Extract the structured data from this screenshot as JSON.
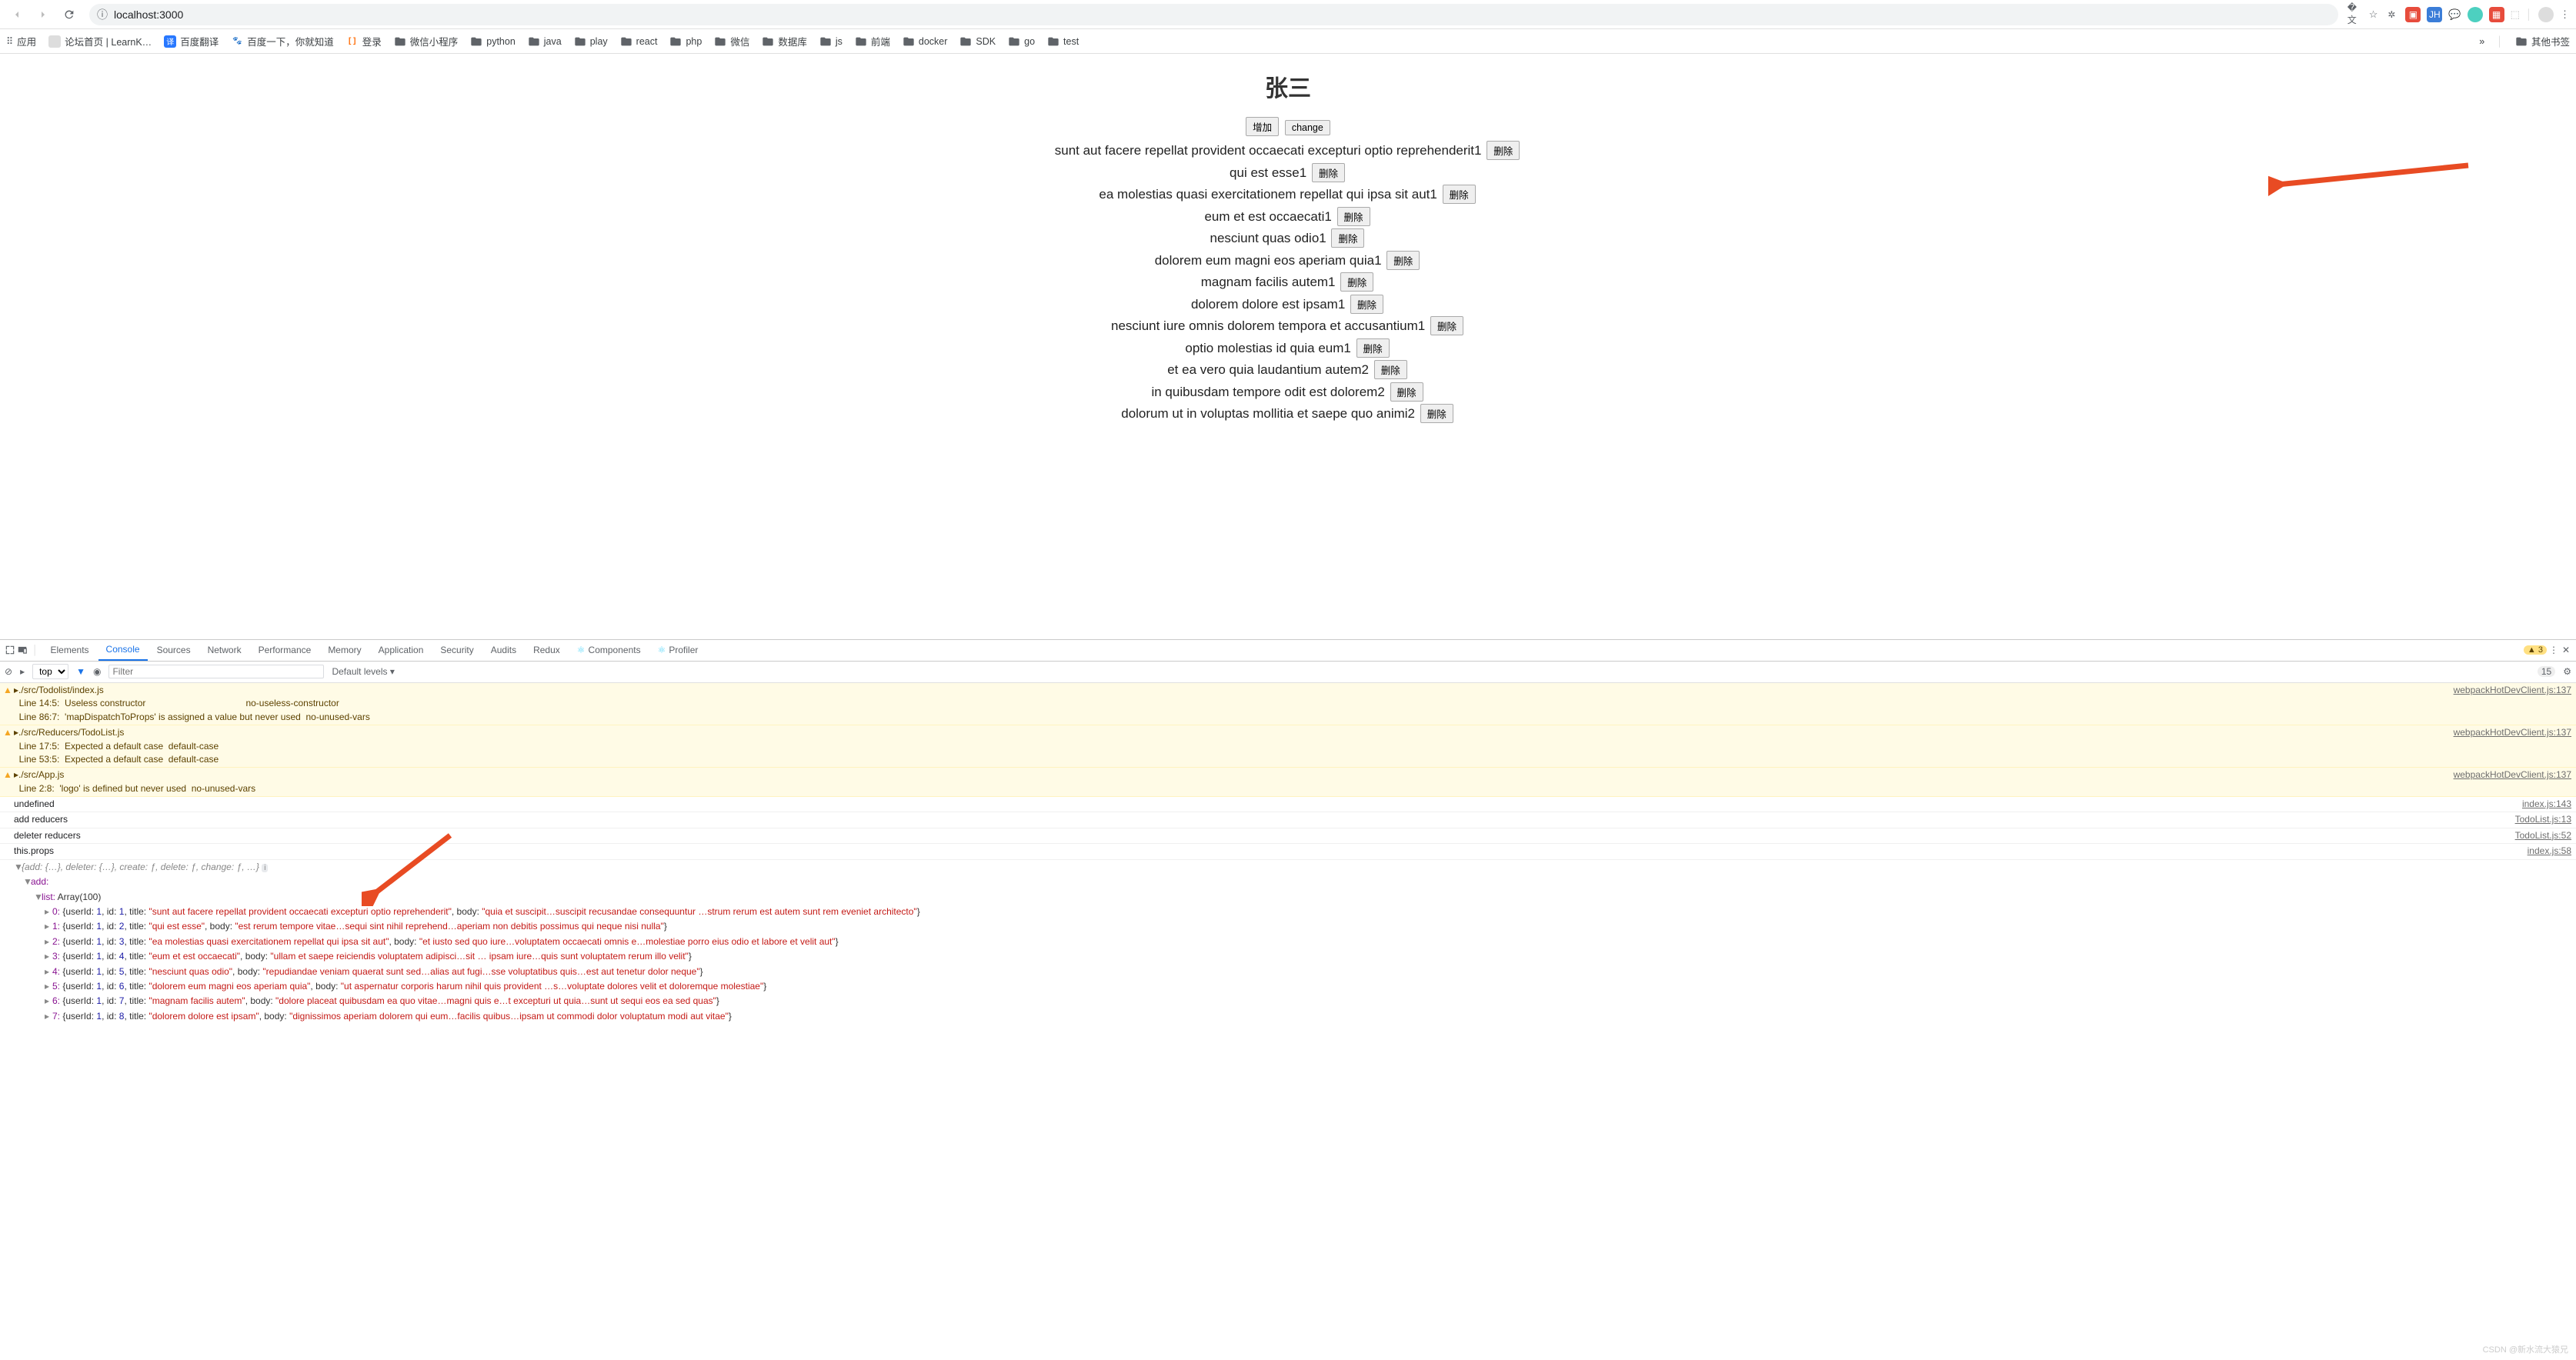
{
  "toolbar": {
    "url": "localhost:3000"
  },
  "bookmarks": {
    "apps": "应用",
    "items": [
      {
        "label": "论坛首页 | LearnK…",
        "iconBg": "#ddd",
        "iconTxt": "",
        "type": "img"
      },
      {
        "label": "百度翻译",
        "iconBg": "#2878ff",
        "iconTxt": "译",
        "type": "img"
      },
      {
        "label": "百度一下，你就知道",
        "iconBg": "#fff",
        "iconTxt": "",
        "type": "paw"
      },
      {
        "label": "登录",
        "iconBg": "#ff6a00",
        "iconTxt": "",
        "type": "bracket"
      },
      {
        "label": "微信小程序",
        "type": "folder"
      },
      {
        "label": "python",
        "type": "folder"
      },
      {
        "label": "java",
        "type": "folder"
      },
      {
        "label": "play",
        "type": "folder"
      },
      {
        "label": "react",
        "type": "folder"
      },
      {
        "label": "php",
        "type": "folder"
      },
      {
        "label": "微信",
        "type": "folder"
      },
      {
        "label": "数据库",
        "type": "folder"
      },
      {
        "label": "js",
        "type": "folder"
      },
      {
        "label": "前端",
        "type": "folder"
      },
      {
        "label": "docker",
        "type": "folder"
      },
      {
        "label": "SDK",
        "type": "folder"
      },
      {
        "label": "go",
        "type": "folder"
      },
      {
        "label": "test",
        "type": "folder"
      }
    ],
    "more": "»",
    "other": "其他书签"
  },
  "page": {
    "title": "张三",
    "add_label": "增加",
    "change_label": "change",
    "delete_label": "删除",
    "items": [
      "sunt aut facere repellat provident occaecati excepturi optio reprehenderit1",
      "qui est esse1",
      "ea molestias quasi exercitationem repellat qui ipsa sit aut1",
      "eum et est occaecati1",
      "nesciunt quas odio1",
      "dolorem eum magni eos aperiam quia1",
      "magnam facilis autem1",
      "dolorem dolore est ipsam1",
      "nesciunt iure omnis dolorem tempora et accusantium1",
      "optio molestias id quia eum1",
      "et ea vero quia laudantium autem2",
      "in quibusdam tempore odit est dolorem2",
      "dolorum ut in voluptas mollitia et saepe quo animi2"
    ]
  },
  "devtools": {
    "tabs": [
      "Elements",
      "Console",
      "Sources",
      "Network",
      "Performance",
      "Memory",
      "Application",
      "Security",
      "Audits",
      "Redux",
      "Components",
      "Profiler"
    ],
    "active_tab": "Console",
    "warn_count": "3",
    "hidden_count": "15",
    "context": "top",
    "filter_placeholder": "Filter",
    "levels": "Default levels",
    "warnings": [
      {
        "src": "webpackHotDevClient.js:137",
        "lines": [
          "./src/Todolist/index.js",
          "  Line 14:5:  Useless constructor                                       no-useless-constructor",
          "  Line 86:7:  'mapDispatchToProps' is assigned a value but never used  no-unused-vars"
        ]
      },
      {
        "src": "webpackHotDevClient.js:137",
        "lines": [
          "./src/Reducers/TodoList.js",
          "  Line 17:5:  Expected a default case  default-case",
          "  Line 53:5:  Expected a default case  default-case"
        ]
      },
      {
        "src": "webpackHotDevClient.js:137",
        "lines": [
          "./src/App.js",
          "  Line 2:8:  'logo' is defined but never used  no-unused-vars"
        ]
      }
    ],
    "logs": [
      {
        "txt": "undefined",
        "src": "index.js:143"
      },
      {
        "txt": "add reducers",
        "src": "TodoList.js:13"
      },
      {
        "txt": "deleter reducers",
        "src": "TodoList.js:52"
      },
      {
        "txt": "this.props",
        "src": "index.js:58"
      }
    ],
    "object_summary": "{add: {…}, deleter: {…}, create: ƒ, delete: ƒ, change: ƒ, …}",
    "add_key": "add:",
    "list_label": "list: ",
    "list_type": "Array(100)",
    "list_items": [
      {
        "idx": "0",
        "userId": "1",
        "id": "1",
        "title": "sunt aut facere repellat provident occaecati excepturi optio reprehenderit",
        "body": "quia et suscipit…suscipit recusandae consequuntur …strum rerum est autem sunt rem eveniet architecto"
      },
      {
        "idx": "1",
        "userId": "1",
        "id": "2",
        "title": "qui est esse",
        "body": "est rerum tempore vitae…sequi sint nihil reprehend…aperiam non debitis possimus qui neque nisi nulla"
      },
      {
        "idx": "2",
        "userId": "1",
        "id": "3",
        "title": "ea molestias quasi exercitationem repellat qui ipsa sit aut",
        "body": "et iusto sed quo iure…voluptatem occaecati omnis e…molestiae porro eius odio et labore et velit aut"
      },
      {
        "idx": "3",
        "userId": "1",
        "id": "4",
        "title": "eum et est occaecati",
        "body": "ullam et saepe reiciendis voluptatem adipisci…sit … ipsam iure…quis sunt voluptatem rerum illo velit"
      },
      {
        "idx": "4",
        "userId": "1",
        "id": "5",
        "title": "nesciunt quas odio",
        "body": "repudiandae veniam quaerat sunt sed…alias aut fugi…sse voluptatibus quis…est aut tenetur dolor neque"
      },
      {
        "idx": "5",
        "userId": "1",
        "id": "6",
        "title": "dolorem eum magni eos aperiam quia",
        "body": "ut aspernatur corporis harum nihil quis provident …s…voluptate dolores velit et doloremque molestiae"
      },
      {
        "idx": "6",
        "userId": "1",
        "id": "7",
        "title": "magnam facilis autem",
        "body": "dolore placeat quibusdam ea quo vitae…magni quis e…t excepturi ut quia…sunt ut sequi eos ea sed quas"
      },
      {
        "idx": "7",
        "userId": "1",
        "id": "8",
        "title": "dolorem dolore est ipsam",
        "body": "dignissimos aperiam dolorem qui eum…facilis quibus…ipsam ut commodi dolor voluptatum modi aut vitae"
      }
    ]
  },
  "watermark": "CSDN @新水流大猿兄"
}
